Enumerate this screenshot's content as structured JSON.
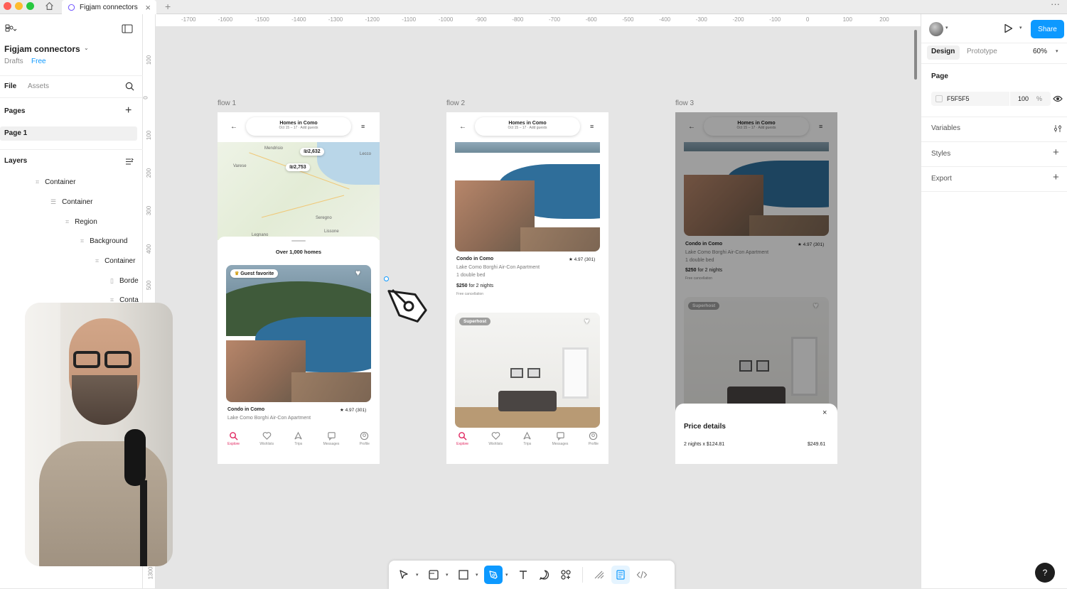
{
  "window": {
    "tab_title": "Figjam connectors"
  },
  "file": {
    "name": "Figjam connectors",
    "location": "Drafts",
    "plan": "Free"
  },
  "left_panel": {
    "tabs": [
      "File",
      "Assets"
    ],
    "pages_label": "Pages",
    "pages": [
      "Page 1"
    ],
    "layers_label": "Layers",
    "layers": [
      "Container",
      "Container",
      "Region",
      "Background",
      "Container",
      "Borde",
      "Conta"
    ]
  },
  "ruler": {
    "h_ticks": [
      "-1700",
      "-1600",
      "-1500",
      "-1400",
      "-1300",
      "-1200",
      "-1100",
      "-1000",
      "-900",
      "-800",
      "-700",
      "-600",
      "-500",
      "-400",
      "-300",
      "-200",
      "-100",
      "0",
      "100",
      "200"
    ],
    "v_ticks": [
      "100",
      "0",
      "100",
      "200",
      "300",
      "400",
      "500",
      "1300"
    ]
  },
  "frames": [
    {
      "label": "flow 1"
    },
    {
      "label": "flow 2"
    },
    {
      "label": "flow 3"
    }
  ],
  "listing": {
    "header_title": "Homes in Como",
    "header_sub": "Oct 15 – 17 · Add guests",
    "count": "Over 1,000 homes",
    "badge_guest": "Guest favorite",
    "badge_superhost": "Superhost",
    "title": "Condo in Como",
    "rating": "★ 4.97 (301)",
    "subtitle": "Lake Como Borghi Air-Con Apartment",
    "beds": "1 double bed",
    "price": "$250",
    "price_suffix": "for 2 nights",
    "cancel": "Free cancellation",
    "map_labels": [
      "Mendrisio",
      "Varese",
      "Lecco",
      "Seregno",
      "Lissone",
      "Legnano"
    ],
    "map_prices": [
      "₪2,632",
      "₪2,753"
    ]
  },
  "bottom_nav": [
    "Explore",
    "Wishlists",
    "Trips",
    "Messages",
    "Profile"
  ],
  "price_sheet": {
    "title": "Price details",
    "line": "2 nights x $124.81",
    "total": "$249.61",
    "close": "×"
  },
  "right_panel": {
    "tabs": [
      "Design",
      "Prototype"
    ],
    "zoom": "60%",
    "share": "Share",
    "page_label": "Page",
    "page_color": "F5F5F5",
    "page_opacity": "100",
    "percent": "%",
    "sections": [
      "Variables",
      "Styles",
      "Export"
    ]
  },
  "help": "?",
  "colors": {
    "accent": "#0d99ff",
    "brand_pink": "#e0245e",
    "canvas": "#e5e5e5"
  }
}
